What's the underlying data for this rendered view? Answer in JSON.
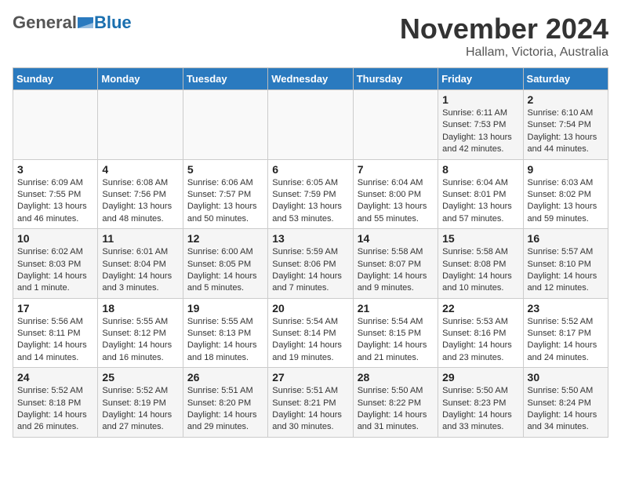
{
  "header": {
    "logo_general": "General",
    "logo_blue": "Blue",
    "title": "November 2024",
    "subtitle": "Hallam, Victoria, Australia"
  },
  "weekdays": [
    "Sunday",
    "Monday",
    "Tuesday",
    "Wednesday",
    "Thursday",
    "Friday",
    "Saturday"
  ],
  "weeks": [
    [
      {
        "day": "",
        "info": ""
      },
      {
        "day": "",
        "info": ""
      },
      {
        "day": "",
        "info": ""
      },
      {
        "day": "",
        "info": ""
      },
      {
        "day": "",
        "info": ""
      },
      {
        "day": "1",
        "info": "Sunrise: 6:11 AM\nSunset: 7:53 PM\nDaylight: 13 hours\nand 42 minutes."
      },
      {
        "day": "2",
        "info": "Sunrise: 6:10 AM\nSunset: 7:54 PM\nDaylight: 13 hours\nand 44 minutes."
      }
    ],
    [
      {
        "day": "3",
        "info": "Sunrise: 6:09 AM\nSunset: 7:55 PM\nDaylight: 13 hours\nand 46 minutes."
      },
      {
        "day": "4",
        "info": "Sunrise: 6:08 AM\nSunset: 7:56 PM\nDaylight: 13 hours\nand 48 minutes."
      },
      {
        "day": "5",
        "info": "Sunrise: 6:06 AM\nSunset: 7:57 PM\nDaylight: 13 hours\nand 50 minutes."
      },
      {
        "day": "6",
        "info": "Sunrise: 6:05 AM\nSunset: 7:59 PM\nDaylight: 13 hours\nand 53 minutes."
      },
      {
        "day": "7",
        "info": "Sunrise: 6:04 AM\nSunset: 8:00 PM\nDaylight: 13 hours\nand 55 minutes."
      },
      {
        "day": "8",
        "info": "Sunrise: 6:04 AM\nSunset: 8:01 PM\nDaylight: 13 hours\nand 57 minutes."
      },
      {
        "day": "9",
        "info": "Sunrise: 6:03 AM\nSunset: 8:02 PM\nDaylight: 13 hours\nand 59 minutes."
      }
    ],
    [
      {
        "day": "10",
        "info": "Sunrise: 6:02 AM\nSunset: 8:03 PM\nDaylight: 14 hours\nand 1 minute."
      },
      {
        "day": "11",
        "info": "Sunrise: 6:01 AM\nSunset: 8:04 PM\nDaylight: 14 hours\nand 3 minutes."
      },
      {
        "day": "12",
        "info": "Sunrise: 6:00 AM\nSunset: 8:05 PM\nDaylight: 14 hours\nand 5 minutes."
      },
      {
        "day": "13",
        "info": "Sunrise: 5:59 AM\nSunset: 8:06 PM\nDaylight: 14 hours\nand 7 minutes."
      },
      {
        "day": "14",
        "info": "Sunrise: 5:58 AM\nSunset: 8:07 PM\nDaylight: 14 hours\nand 9 minutes."
      },
      {
        "day": "15",
        "info": "Sunrise: 5:58 AM\nSunset: 8:08 PM\nDaylight: 14 hours\nand 10 minutes."
      },
      {
        "day": "16",
        "info": "Sunrise: 5:57 AM\nSunset: 8:10 PM\nDaylight: 14 hours\nand 12 minutes."
      }
    ],
    [
      {
        "day": "17",
        "info": "Sunrise: 5:56 AM\nSunset: 8:11 PM\nDaylight: 14 hours\nand 14 minutes."
      },
      {
        "day": "18",
        "info": "Sunrise: 5:55 AM\nSunset: 8:12 PM\nDaylight: 14 hours\nand 16 minutes."
      },
      {
        "day": "19",
        "info": "Sunrise: 5:55 AM\nSunset: 8:13 PM\nDaylight: 14 hours\nand 18 minutes."
      },
      {
        "day": "20",
        "info": "Sunrise: 5:54 AM\nSunset: 8:14 PM\nDaylight: 14 hours\nand 19 minutes."
      },
      {
        "day": "21",
        "info": "Sunrise: 5:54 AM\nSunset: 8:15 PM\nDaylight: 14 hours\nand 21 minutes."
      },
      {
        "day": "22",
        "info": "Sunrise: 5:53 AM\nSunset: 8:16 PM\nDaylight: 14 hours\nand 23 minutes."
      },
      {
        "day": "23",
        "info": "Sunrise: 5:52 AM\nSunset: 8:17 PM\nDaylight: 14 hours\nand 24 minutes."
      }
    ],
    [
      {
        "day": "24",
        "info": "Sunrise: 5:52 AM\nSunset: 8:18 PM\nDaylight: 14 hours\nand 26 minutes."
      },
      {
        "day": "25",
        "info": "Sunrise: 5:52 AM\nSunset: 8:19 PM\nDaylight: 14 hours\nand 27 minutes."
      },
      {
        "day": "26",
        "info": "Sunrise: 5:51 AM\nSunset: 8:20 PM\nDaylight: 14 hours\nand 29 minutes."
      },
      {
        "day": "27",
        "info": "Sunrise: 5:51 AM\nSunset: 8:21 PM\nDaylight: 14 hours\nand 30 minutes."
      },
      {
        "day": "28",
        "info": "Sunrise: 5:50 AM\nSunset: 8:22 PM\nDaylight: 14 hours\nand 31 minutes."
      },
      {
        "day": "29",
        "info": "Sunrise: 5:50 AM\nSunset: 8:23 PM\nDaylight: 14 hours\nand 33 minutes."
      },
      {
        "day": "30",
        "info": "Sunrise: 5:50 AM\nSunset: 8:24 PM\nDaylight: 14 hours\nand 34 minutes."
      }
    ]
  ]
}
